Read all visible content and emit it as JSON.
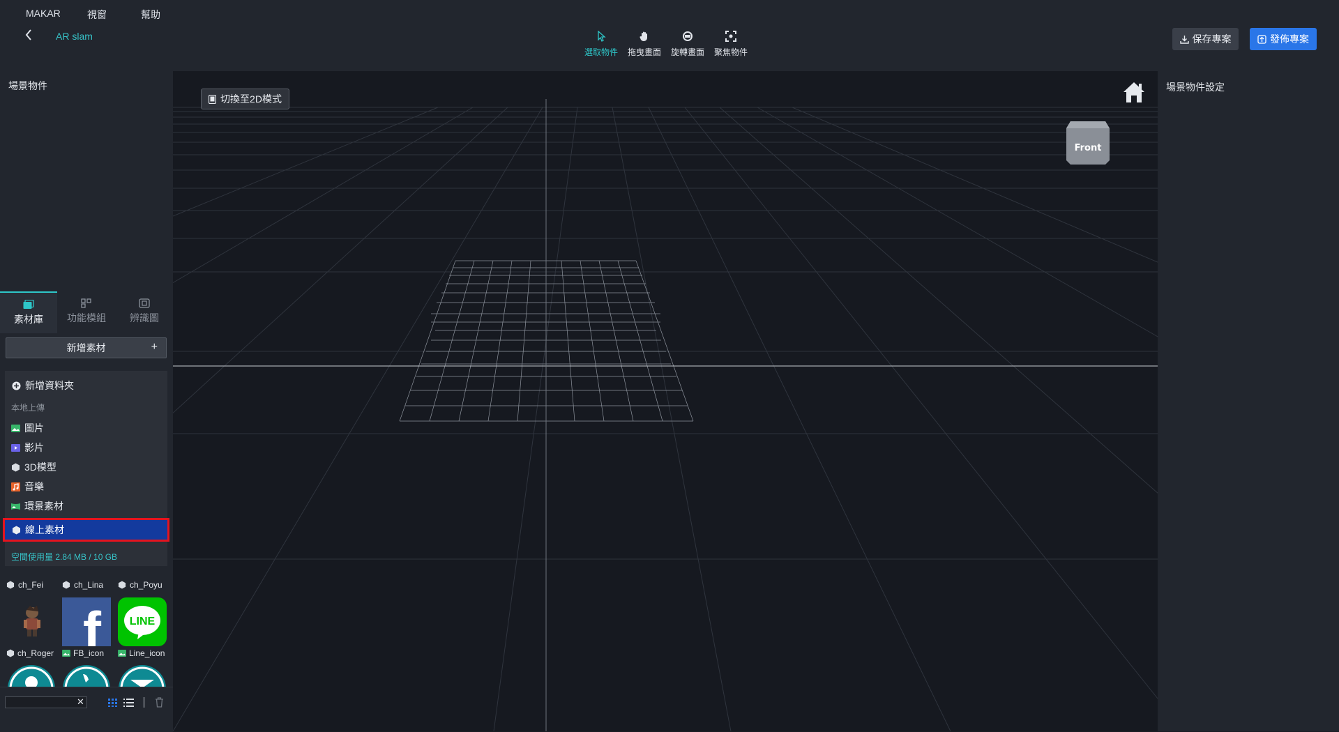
{
  "menu": {
    "items": [
      "MAKAR",
      "視窗",
      "幫助"
    ]
  },
  "project": {
    "name": "AR slam"
  },
  "tools": [
    {
      "label": "選取物件",
      "icon": "cursor-icon",
      "active": true
    },
    {
      "label": "拖曳畫面",
      "icon": "hand-icon",
      "active": false
    },
    {
      "label": "旋轉畫面",
      "icon": "rotate-icon",
      "active": false
    },
    {
      "label": "聚焦物件",
      "icon": "focus-icon",
      "active": false
    }
  ],
  "actions": {
    "save": "保存專案",
    "publish": "發佈專案"
  },
  "left_panel": {
    "title": "場景物件",
    "tabs": [
      {
        "label": "素材庫",
        "icon": "image-library-icon",
        "active": true
      },
      {
        "label": "功能模組",
        "icon": "modules-icon",
        "active": false
      },
      {
        "label": "辨識圖",
        "icon": "target-image-icon",
        "active": false
      }
    ],
    "add_asset": "新增素材",
    "add_asset_plus": "+"
  },
  "dropdown": {
    "new_folder": "新增資料夾",
    "local_upload_label": "本地上傳",
    "items": [
      {
        "label": "圖片",
        "icon": "image-icon",
        "color": "#38b56a"
      },
      {
        "label": "影片",
        "icon": "video-icon",
        "color": "#6a62e8"
      },
      {
        "label": "3D模型",
        "icon": "cube-icon",
        "color": "#d9dde3"
      },
      {
        "label": "音樂",
        "icon": "music-icon",
        "color": "#e8632a"
      },
      {
        "label": "環景素材",
        "icon": "panorama-icon",
        "color": "#38b56a"
      }
    ],
    "online": {
      "label": "線上素材",
      "icon": "cube-icon"
    },
    "storage": "空間使用量 2.84 MB / 10 GB"
  },
  "assets": {
    "row1_names": [
      {
        "name": "ch_Fei",
        "icon": "cube-icon"
      },
      {
        "name": "ch_Lina",
        "icon": "cube-icon"
      },
      {
        "name": "ch_Poyu",
        "icon": "cube-icon"
      }
    ],
    "row2_names": [
      {
        "name": "ch_Roger",
        "icon": "cube-icon"
      },
      {
        "name": "FB_icon",
        "icon": "image-icon"
      },
      {
        "name": "Line_icon",
        "icon": "image-icon"
      }
    ],
    "thumbs": [
      {
        "name": "character-thumbnail",
        "icon": "character-icon"
      },
      {
        "name": "facebook-thumbnail",
        "icon": "facebook-logo-icon",
        "letter": "f",
        "color": "#3b5998"
      },
      {
        "name": "line-thumbnail",
        "icon": "line-logo-icon",
        "letter": "LINE",
        "color": "#00c300"
      }
    ]
  },
  "viewport": {
    "switch_2d": "切換至2D模式",
    "view_cube_label": "Front"
  },
  "right_panel": {
    "title": "場景物件設定"
  },
  "colors": {
    "accent": "#2ec7c9",
    "primary": "#2a76e8",
    "highlight_border": "#e4141f",
    "selected": "#133a9e"
  }
}
